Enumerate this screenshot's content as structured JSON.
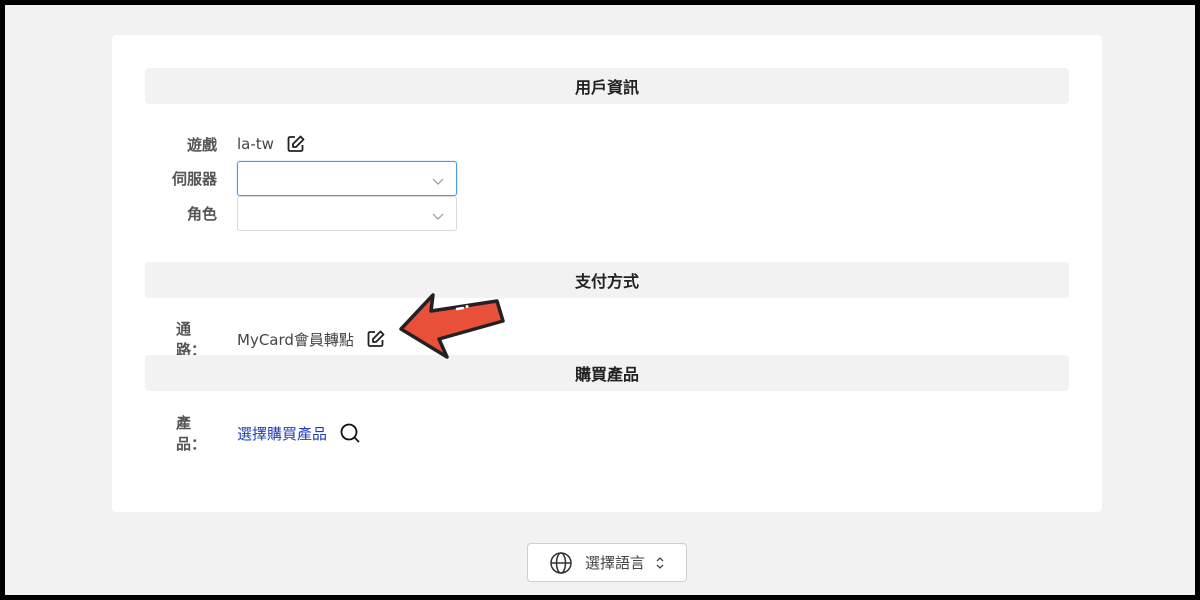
{
  "user_info": {
    "header": "用戶資訊",
    "game_label": "遊戲",
    "game_value": "la-tw",
    "server_label": "伺服器",
    "role_label": "角色"
  },
  "payment": {
    "header": "支付方式",
    "channel_label": "通路：",
    "channel_value": "MyCard會員轉點"
  },
  "product": {
    "header": "購買產品",
    "product_label": "產品：",
    "product_link": "選擇購買產品"
  },
  "language": {
    "button_label": "選擇語言"
  },
  "colors": {
    "accent_link": "#1f3fb8",
    "focus_border": "#4b9be0",
    "arrow_fill": "#e8503a"
  },
  "icons": [
    "edit-icon",
    "chevron-down-icon",
    "search-icon",
    "globe-icon",
    "sort-icon",
    "arrow-pointer-icon"
  ]
}
